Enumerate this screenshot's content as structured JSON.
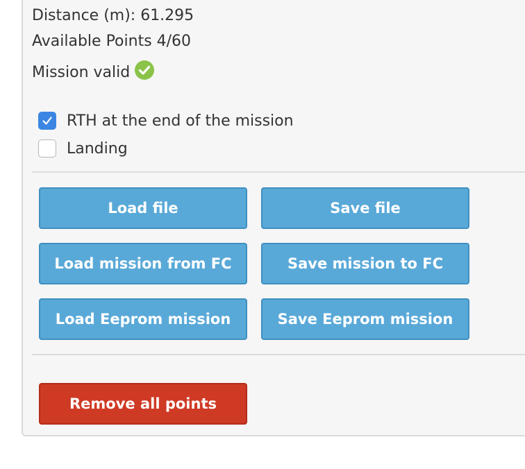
{
  "stats": {
    "distance": "Distance (m): 61.295",
    "available_points": "Available Points 4/60",
    "mission_status": "Mission valid"
  },
  "options": [
    {
      "label": "RTH at the end of the mission",
      "checked": true
    },
    {
      "label": "Landing",
      "checked": false
    }
  ],
  "buttons": {
    "load_file": "Load file",
    "save_file": "Save file",
    "load_mission_fc": "Load mission from FC",
    "save_mission_fc": "Save mission to FC",
    "load_eeprom": "Load Eeprom mission",
    "save_eeprom": "Save Eeprom mission",
    "remove_all": "Remove all points"
  },
  "colors": {
    "button_blue": "#59a9d8",
    "button_red": "#cf3a25",
    "valid_green": "#8bc34a",
    "checkbox_blue": "#3b86e2"
  }
}
